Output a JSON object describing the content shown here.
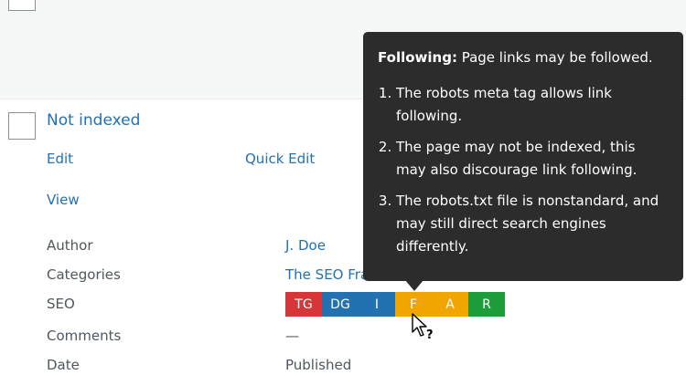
{
  "post_title": "Not indexed",
  "row_actions": {
    "edit": "Edit",
    "quick_edit": "Quick Edit",
    "view": "View"
  },
  "fields": {
    "author_label": "Author",
    "author_value": "J. Doe",
    "categories_label": "Categories",
    "categories_value": "The SEO Fra",
    "seo_label": "SEO",
    "comments_label": "Comments",
    "comments_value": "—",
    "date_label": "Date",
    "date_value": "Published"
  },
  "seo_segments": [
    {
      "text": "TG",
      "color": "#d63638"
    },
    {
      "text": "DG",
      "color": "#2271b1"
    },
    {
      "text": "I",
      "color": "#2271b1"
    },
    {
      "text": "F",
      "color": "#f0a500"
    },
    {
      "text": "A",
      "color": "#f0a500"
    },
    {
      "text": "R",
      "color": "#1e9e3a"
    }
  ],
  "tooltip": {
    "heading_bold": "Following:",
    "heading_rest": " Page links may be followed.",
    "items": [
      "The robots meta tag allows link following.",
      "The page may not be indexed, this may also discourage link following.",
      "The robots.txt file is nonstandard, and may still direct search engines differently."
    ]
  },
  "icons": {
    "cursor": "help-cursor-icon"
  }
}
